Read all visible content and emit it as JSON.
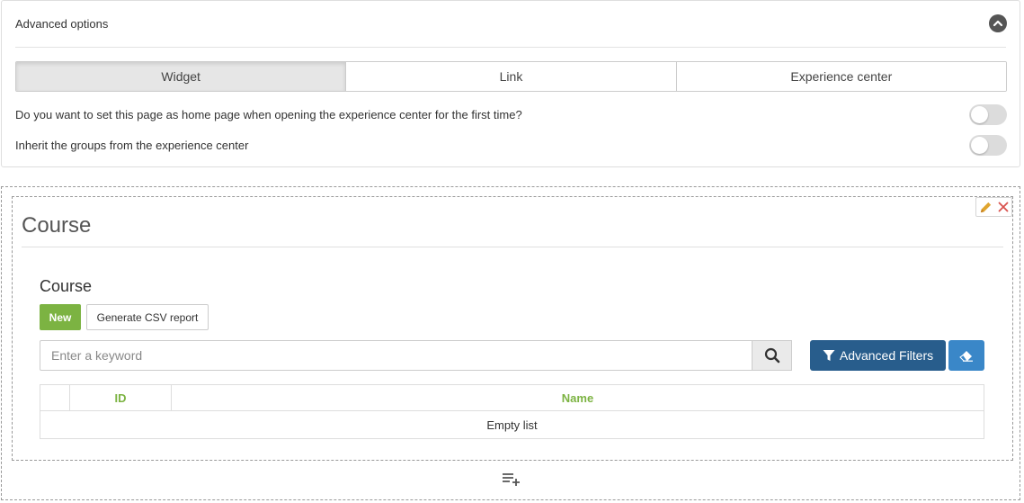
{
  "advanced_options": {
    "title": "Advanced options",
    "tabs": [
      {
        "label": "Widget",
        "active": true
      },
      {
        "label": "Link",
        "active": false
      },
      {
        "label": "Experience center",
        "active": false
      }
    ],
    "options": [
      {
        "label": "Do you want to set this page as home page when opening the experience center for the first time?",
        "enabled": false
      },
      {
        "label": "Inherit the groups from the experience center",
        "enabled": false
      }
    ]
  },
  "widget": {
    "title": "Course",
    "list_title": "Course",
    "new_label": "New",
    "csv_label": "Generate CSV report",
    "search": {
      "placeholder": "Enter a keyword",
      "value": ""
    },
    "advanced_filters_label": "Advanced Filters",
    "table": {
      "columns": [
        "",
        "ID",
        "Name"
      ],
      "empty_text": "Empty list"
    }
  },
  "icons": {
    "collapse": "chevron-up-icon",
    "edit": "pencil-icon",
    "close": "close-icon",
    "search": "search-icon",
    "filter": "filter-icon",
    "eraser": "eraser-icon",
    "add_row": "playlist-add-icon"
  },
  "colors": {
    "accent_green": "#7cb342",
    "primary_blue": "#285d8c",
    "light_blue": "#3a87c8",
    "edit_orange": "#e0a530",
    "close_red": "#d9534f"
  }
}
